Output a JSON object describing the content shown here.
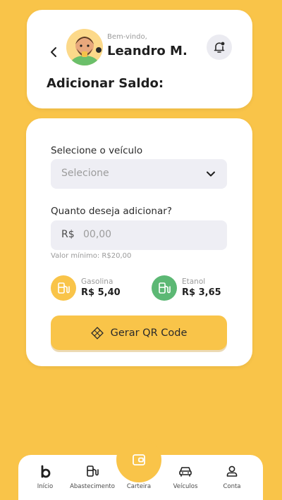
{
  "header": {
    "welcome": "Bem-vindo,",
    "user_name": "Leandro M.",
    "page_title": "Adicionar Saldo:"
  },
  "form": {
    "vehicle_label": "Selecione o veículo",
    "vehicle_value": "Selecione",
    "amount_label": "Quanto deseja adicionar?",
    "amount_prefix": "R$",
    "amount_placeholder": "00,00",
    "min_note": "Valor mínimo: R$20,00"
  },
  "fuels": [
    {
      "name": "Gasolina",
      "price": "R$ 5,40",
      "color": "#F9C449"
    },
    {
      "name": "Etanol",
      "price": "R$ 3,65",
      "color": "#5CB874"
    }
  ],
  "qr_button": {
    "label": "Gerar QR Code"
  },
  "nav": {
    "items": [
      {
        "label": "Início",
        "icon": "home-b-icon"
      },
      {
        "label": "Abastecimento",
        "icon": "fuel-pump-icon"
      },
      {
        "label": "Carteira",
        "icon": "wallet-icon"
      },
      {
        "label": "Veículos",
        "icon": "car-icon"
      },
      {
        "label": "Conta",
        "icon": "user-icon"
      }
    ]
  },
  "colors": {
    "background": "#F9C449",
    "accent": "#F9C449",
    "ethanol": "#5CB874",
    "field": "#EEEEF4"
  }
}
